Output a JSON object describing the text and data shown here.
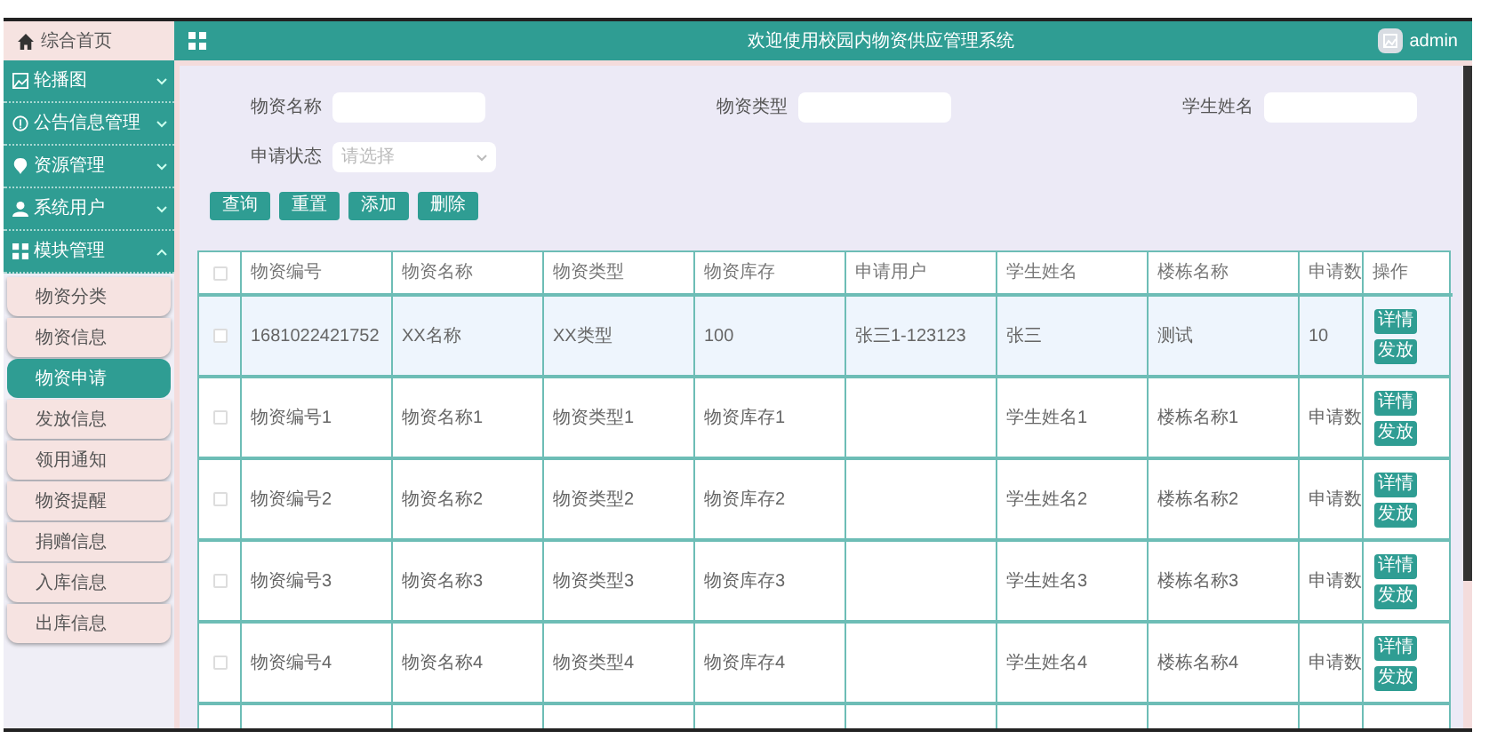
{
  "header": {
    "title": "欢迎使用校园内物资供应管理系统",
    "user": "admin"
  },
  "sidebar": {
    "home": "综合首页",
    "menus": [
      {
        "label": "轮播图",
        "expanded": false
      },
      {
        "label": "公告信息管理",
        "expanded": false
      },
      {
        "label": "资源管理",
        "expanded": false
      },
      {
        "label": "系统用户",
        "expanded": false
      },
      {
        "label": "模块管理",
        "expanded": true,
        "children": [
          {
            "label": "物资分类",
            "selected": false
          },
          {
            "label": "物资信息",
            "selected": false
          },
          {
            "label": "物资申请",
            "selected": true
          },
          {
            "label": "发放信息",
            "selected": false
          },
          {
            "label": "领用通知",
            "selected": false
          },
          {
            "label": "物资提醒",
            "selected": false
          },
          {
            "label": "捐赠信息",
            "selected": false
          },
          {
            "label": "入库信息",
            "selected": false
          },
          {
            "label": "出库信息",
            "selected": false
          }
        ]
      }
    ]
  },
  "search": {
    "fields": [
      {
        "label": "物资名称",
        "kind": "text"
      },
      {
        "label": "物资类型",
        "kind": "text"
      },
      {
        "label": "学生姓名",
        "kind": "text"
      },
      {
        "label": "申请状态",
        "kind": "select",
        "placeholder": "请选择"
      }
    ],
    "buttons": [
      "查询",
      "重置",
      "添加",
      "删除"
    ]
  },
  "table": {
    "all_checked": false,
    "columns": [
      "物资编号",
      "物资名称",
      "物资类型",
      "物资库存",
      "申请用户",
      "学生姓名",
      "楼栋名称",
      "申请数",
      "操作"
    ],
    "rows": [
      {
        "selected": true,
        "checked": false,
        "cells": [
          "1681022421752",
          "XX名称",
          "XX类型",
          "100",
          "张三1-123123",
          "张三",
          "测试",
          "10"
        ],
        "actions": [
          "详情",
          "发放"
        ]
      },
      {
        "selected": false,
        "checked": false,
        "cells": [
          "物资编号1",
          "物资名称1",
          "物资类型1",
          "物资库存1",
          "",
          "学生姓名1",
          "楼栋名称1",
          "申请数"
        ],
        "actions": [
          "详情",
          "发放"
        ]
      },
      {
        "selected": false,
        "checked": false,
        "cells": [
          "物资编号2",
          "物资名称2",
          "物资类型2",
          "物资库存2",
          "",
          "学生姓名2",
          "楼栋名称2",
          "申请数"
        ],
        "actions": [
          "详情",
          "发放"
        ]
      },
      {
        "selected": false,
        "checked": false,
        "cells": [
          "物资编号3",
          "物资名称3",
          "物资类型3",
          "物资库存3",
          "",
          "学生姓名3",
          "楼栋名称3",
          "申请数"
        ],
        "actions": [
          "详情",
          "发放"
        ]
      },
      {
        "selected": false,
        "checked": false,
        "cells": [
          "物资编号4",
          "物资名称4",
          "物资类型4",
          "物资库存4",
          "",
          "学生姓名4",
          "楼栋名称4",
          "申请数"
        ],
        "actions": [
          "详情",
          "发放"
        ]
      }
    ]
  }
}
